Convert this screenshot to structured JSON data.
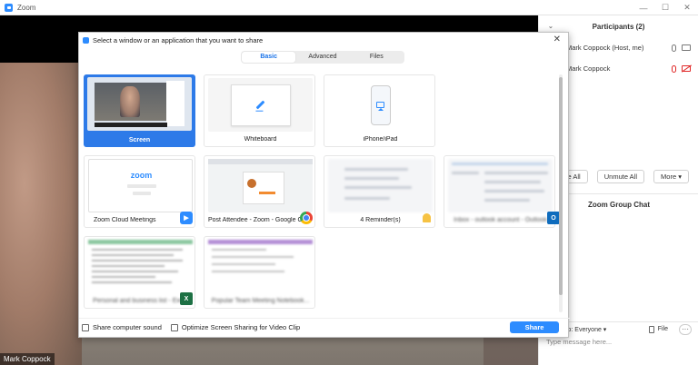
{
  "window": {
    "title": "Zoom",
    "minimize": "—",
    "maximize": "☐",
    "close": "✕"
  },
  "video": {
    "name_tag": "Mark Coppock"
  },
  "participants": {
    "header": "Participants (2)",
    "items": [
      {
        "name": "Mark Coppock (Host, me)",
        "mic": "on",
        "camera": "on"
      },
      {
        "name": "Mark Coppock",
        "mic": "muted",
        "camera": "off"
      }
    ],
    "mute_all_label": "Mute All",
    "unmute_all_label": "Unmute All",
    "more_label": "More ▾"
  },
  "chat": {
    "title": "Zoom Group Chat",
    "to_label": "To: Everyone ▾",
    "file_label": "File",
    "more_dots": "···",
    "placeholder": "Type message here..."
  },
  "share_dialog": {
    "title": "Select a window or an application that you want to share",
    "tabs": [
      {
        "label": "Basic",
        "active": true
      },
      {
        "label": "Advanced",
        "active": false
      },
      {
        "label": "Files",
        "active": false
      }
    ],
    "tiles": [
      {
        "label": "Screen",
        "kind": "screen",
        "selected": true
      },
      {
        "label": "Whiteboard",
        "kind": "whiteboard"
      },
      {
        "label": "iPhone/iPad",
        "kind": "ios"
      },
      {
        "label": "Zoom Cloud Meetings",
        "kind": "app",
        "app_icon": "zoom-app-icon",
        "thumb_logo": "zoom"
      },
      {
        "label": "Post Attendee - Zoom - Google C...",
        "kind": "app",
        "app_icon": "chrome-app-icon"
      },
      {
        "label": "4 Reminder(s)",
        "kind": "app",
        "app_icon": "bell-icon"
      },
      {
        "label": "Inbox - outlook account - Outlook",
        "kind": "app",
        "app_icon": "outlook-app-icon",
        "blurred": true
      },
      {
        "label": "Personal and business list - Excel",
        "kind": "app",
        "app_icon": "excel-app-icon",
        "blurred": true
      },
      {
        "label": "Popular Team Meeting Notebook...",
        "kind": "app",
        "app_icon": "onenote-app-icon",
        "blurred": true
      }
    ],
    "share_sound_label": "Share computer sound",
    "optimize_label": "Optimize Screen Sharing for Video Clip",
    "share_button": "Share",
    "close_glyph": "✕"
  },
  "colors": {
    "accent": "#2d8cff",
    "selected_tile": "#2d7ae8",
    "mute_red": "#e02828"
  }
}
